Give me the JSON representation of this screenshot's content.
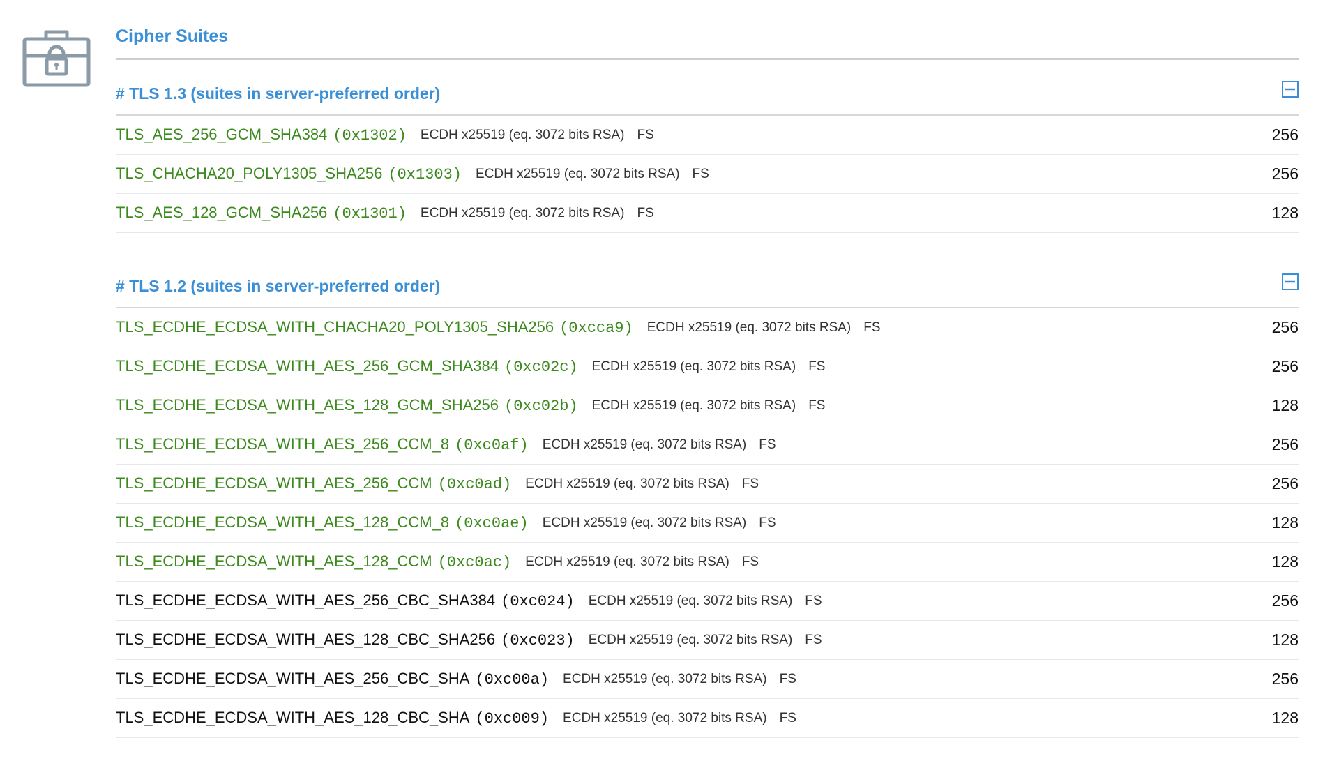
{
  "section": {
    "title": "Cipher Suites",
    "icon": "lock-toolbox-icon"
  },
  "colors": {
    "accent": "#3a8fd6",
    "good": "#3c8a1e",
    "normal": "#111111",
    "icon": "#8a9aa6"
  },
  "groups": [
    {
      "title": "# TLS 1.3 (suites in server-preferred order)",
      "collapse_icon": "minus-square-icon",
      "rows": [
        {
          "name": "TLS_AES_256_GCM_SHA384",
          "code": "(0x1302)",
          "kex": "ECDH x25519 (eq. 3072 bits RSA)",
          "fs": "FS",
          "bits": "256",
          "good": true
        },
        {
          "name": "TLS_CHACHA20_POLY1305_SHA256",
          "code": "(0x1303)",
          "kex": "ECDH x25519 (eq. 3072 bits RSA)",
          "fs": "FS",
          "bits": "256",
          "good": true
        },
        {
          "name": "TLS_AES_128_GCM_SHA256",
          "code": "(0x1301)",
          "kex": "ECDH x25519 (eq. 3072 bits RSA)",
          "fs": "FS",
          "bits": "128",
          "good": true
        }
      ]
    },
    {
      "title": "# TLS 1.2 (suites in server-preferred order)",
      "collapse_icon": "minus-square-icon",
      "rows": [
        {
          "name": "TLS_ECDHE_ECDSA_WITH_CHACHA20_POLY1305_SHA256",
          "code": "(0xcca9)",
          "kex": "ECDH x25519 (eq. 3072 bits RSA)",
          "fs": "FS",
          "bits": "256",
          "good": true
        },
        {
          "name": "TLS_ECDHE_ECDSA_WITH_AES_256_GCM_SHA384",
          "code": "(0xc02c)",
          "kex": "ECDH x25519 (eq. 3072 bits RSA)",
          "fs": "FS",
          "bits": "256",
          "good": true
        },
        {
          "name": "TLS_ECDHE_ECDSA_WITH_AES_128_GCM_SHA256",
          "code": "(0xc02b)",
          "kex": "ECDH x25519 (eq. 3072 bits RSA)",
          "fs": "FS",
          "bits": "128",
          "good": true
        },
        {
          "name": "TLS_ECDHE_ECDSA_WITH_AES_256_CCM_8",
          "code": "(0xc0af)",
          "kex": "ECDH x25519 (eq. 3072 bits RSA)",
          "fs": "FS",
          "bits": "256",
          "good": true
        },
        {
          "name": "TLS_ECDHE_ECDSA_WITH_AES_256_CCM",
          "code": "(0xc0ad)",
          "kex": "ECDH x25519 (eq. 3072 bits RSA)",
          "fs": "FS",
          "bits": "256",
          "good": true
        },
        {
          "name": "TLS_ECDHE_ECDSA_WITH_AES_128_CCM_8",
          "code": "(0xc0ae)",
          "kex": "ECDH x25519 (eq. 3072 bits RSA)",
          "fs": "FS",
          "bits": "128",
          "good": true
        },
        {
          "name": "TLS_ECDHE_ECDSA_WITH_AES_128_CCM",
          "code": "(0xc0ac)",
          "kex": "ECDH x25519 (eq. 3072 bits RSA)",
          "fs": "FS",
          "bits": "128",
          "good": true
        },
        {
          "name": "TLS_ECDHE_ECDSA_WITH_AES_256_CBC_SHA384",
          "code": "(0xc024)",
          "kex": "ECDH x25519 (eq. 3072 bits RSA)",
          "fs": "FS",
          "bits": "256",
          "good": false
        },
        {
          "name": "TLS_ECDHE_ECDSA_WITH_AES_128_CBC_SHA256",
          "code": "(0xc023)",
          "kex": "ECDH x25519 (eq. 3072 bits RSA)",
          "fs": "FS",
          "bits": "128",
          "good": false
        },
        {
          "name": "TLS_ECDHE_ECDSA_WITH_AES_256_CBC_SHA",
          "code": "(0xc00a)",
          "kex": "ECDH x25519 (eq. 3072 bits RSA)",
          "fs": "FS",
          "bits": "256",
          "good": false
        },
        {
          "name": "TLS_ECDHE_ECDSA_WITH_AES_128_CBC_SHA",
          "code": "(0xc009)",
          "kex": "ECDH x25519 (eq. 3072 bits RSA)",
          "fs": "FS",
          "bits": "128",
          "good": false
        }
      ]
    }
  ]
}
